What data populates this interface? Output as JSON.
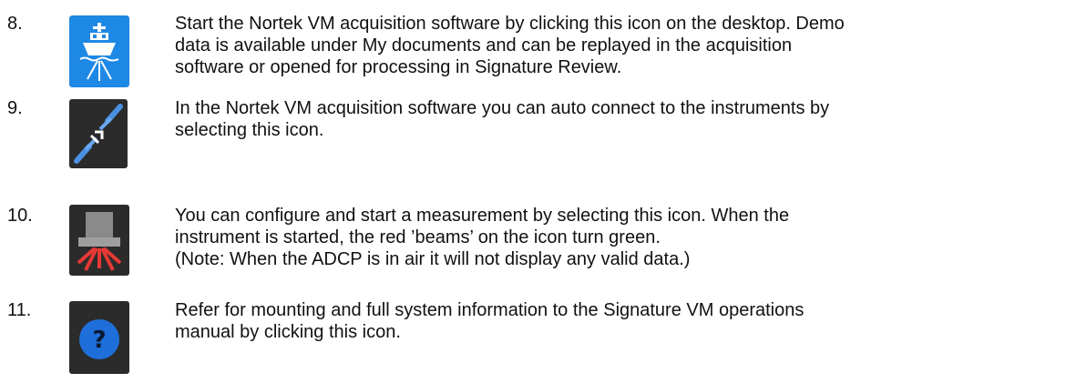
{
  "steps": [
    {
      "number": "8.",
      "icon": "ship-icon",
      "text": "Start the Nortek VM acquisition software by clicking this icon on the desktop. Demo\ndata is available under My documents and can be replayed in the acquisition\nsoftware or opened for processing in Signature Review."
    },
    {
      "number": "9.",
      "icon": "connect-icon",
      "text": "In the Nortek VM acquisition software you can auto connect to the instruments by\nselecting this icon."
    },
    {
      "number": "10.",
      "icon": "instrument-beams-icon",
      "text": "You can configure and start a measurement by selecting this icon. When the\ninstrument is started, the red ’beams’ on the icon turn green.\n(Note: When the ADCP is in air it will not display any valid data.)"
    },
    {
      "number": "11.",
      "icon": "help-icon",
      "text": "Refer for mounting and full system information to the Signature VM operations\nmanual by clicking this icon."
    }
  ],
  "colors": {
    "ship_icon_bg": "#1e88e5",
    "dark_icon_bg": "#2b2b2b",
    "connect_accent": "#4a90e2",
    "beams_red": "#e53935",
    "help_blue": "#1e6fd9"
  }
}
